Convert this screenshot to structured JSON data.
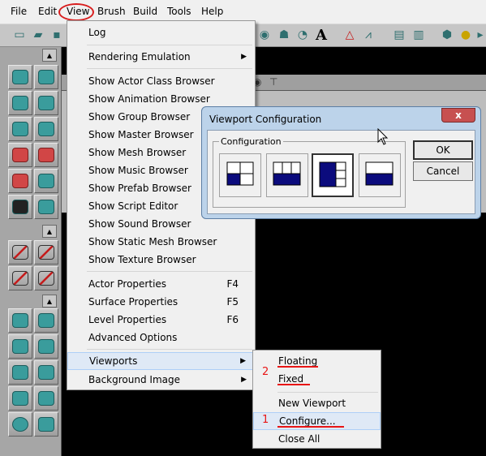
{
  "menubar": {
    "items": [
      "File",
      "Edit",
      "View",
      "Brush",
      "Build",
      "Tools",
      "Help"
    ]
  },
  "view_menu": {
    "items": [
      {
        "label": "Log"
      },
      {
        "label": "Rendering Emulation",
        "submenu": true
      },
      {
        "label": "Show Actor Class Browser"
      },
      {
        "label": "Show Animation Browser"
      },
      {
        "label": "Show Group Browser"
      },
      {
        "label": "Show Master Browser"
      },
      {
        "label": "Show Mesh Browser"
      },
      {
        "label": "Show Music Browser"
      },
      {
        "label": "Show Prefab Browser"
      },
      {
        "label": "Show Script Editor"
      },
      {
        "label": "Show Sound Browser"
      },
      {
        "label": "Show Static Mesh Browser"
      },
      {
        "label": "Show Texture Browser"
      },
      {
        "label": "Actor Properties",
        "shortcut": "F4"
      },
      {
        "label": "Surface Properties",
        "shortcut": "F5"
      },
      {
        "label": "Level Properties",
        "shortcut": "F6"
      },
      {
        "label": "Advanced Options"
      },
      {
        "label": "Viewports",
        "submenu": true,
        "highlighted": true
      },
      {
        "label": "Background Image",
        "submenu": true
      }
    ]
  },
  "viewports_submenu": {
    "items": [
      {
        "label": "Floating"
      },
      {
        "label": "Fixed"
      },
      {
        "label": "New Viewport"
      },
      {
        "label": "Configure...",
        "highlighted": true
      },
      {
        "label": "Close All"
      }
    ]
  },
  "annotations": {
    "step1": "1",
    "step2": "2",
    "color": "#e81515"
  },
  "dialog": {
    "title": "Viewport Configuration",
    "close_glyph": "x",
    "group_label": "Configuration",
    "ok_label": "OK",
    "cancel_label": "Cancel",
    "layouts": [
      "layout-four-split",
      "layout-three-top-one-bottom",
      "layout-one-left-three-right",
      "layout-two-stacked"
    ],
    "selected_layout_index": 2,
    "accent": "#0b0b7d"
  },
  "toolbar": {
    "text_tool_glyph": "A"
  },
  "colors": {
    "viewport_bg": "#000000",
    "menu_bg": "#f0f0f0",
    "highlight": "#dfe9f6"
  }
}
